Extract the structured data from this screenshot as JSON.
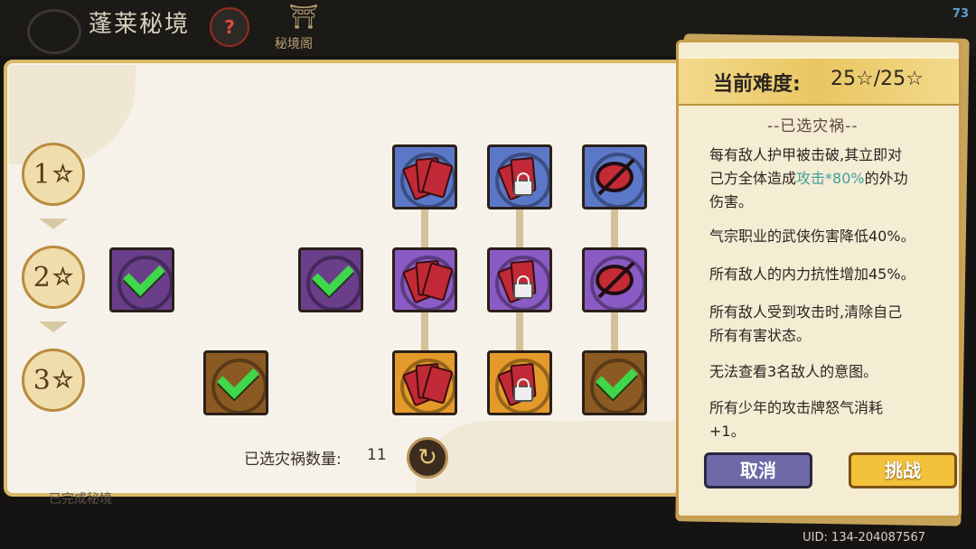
{
  "header": {
    "title": "蓬莱秘境",
    "hint_icon": "?",
    "tab_label": "秘境阁"
  },
  "fps": "73",
  "board": {
    "rows": [
      {
        "label": "1",
        "star": "☆"
      },
      {
        "label": "2",
        "star": "☆"
      },
      {
        "label": "3",
        "star": "☆"
      }
    ],
    "selected_count_label": "已选灾祸数量:",
    "selected_count": "11",
    "reset_icon": "↻",
    "footer_text": "已完成秘境"
  },
  "panel": {
    "difficulty_label": "当前难度:",
    "difficulty_value": "25☆/25☆",
    "section_title": "--已选灾祸--",
    "para1_a": "每有敌人护甲被击破,其立即对",
    "para1_b": "己方全体造成",
    "para1_highlight": "攻击*80%",
    "para1_c": "的外功",
    "para1_d": "伤害。",
    "para2": "气宗职业的武侠伤害降低40%。",
    "para3": "所有敌人的内力抗性增加45%。",
    "para4_a": "所有敌人受到攻击时,清除自己",
    "para4_b": "所有有害状态。",
    "para5": "无法查看3名敌人的意图。",
    "para6_a": "所有少年的攻击牌怒气消耗",
    "para6_b": "+1。",
    "cancel_label": "取消",
    "challenge_label": "挑战"
  },
  "uid": "UID: 134-204087567",
  "colors": {
    "highlight": "#3ea09c",
    "gold": "#f3c23a",
    "cancel": "#6e6aa8"
  }
}
